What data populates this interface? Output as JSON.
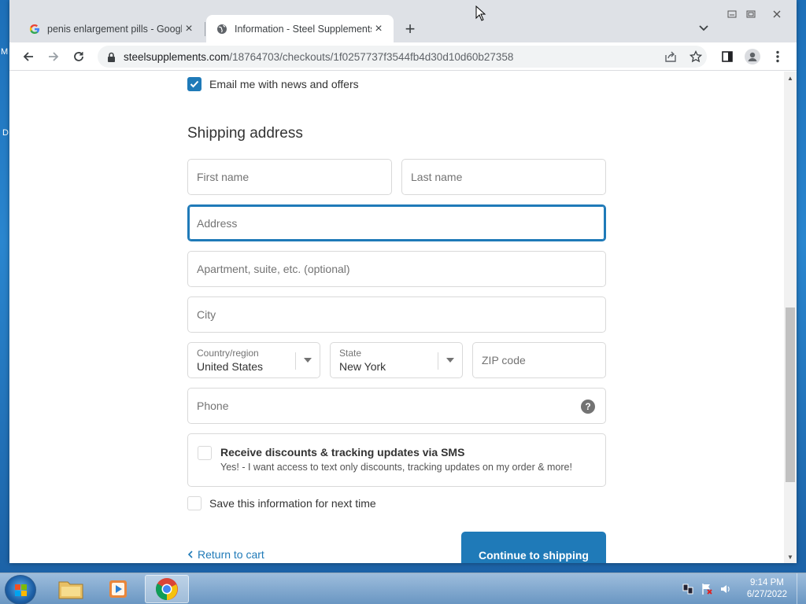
{
  "desktop": {
    "left_letters": [
      "M",
      "D"
    ]
  },
  "browser": {
    "tabs": [
      {
        "title": "penis enlargement pills - Google",
        "active": false,
        "icon": "google-g-icon"
      },
      {
        "title": "Information - Steel Supplements",
        "active": true,
        "icon": "globe-icon"
      }
    ],
    "url_domain": "steelsupplements.com",
    "url_path": "/18764703/checkouts/1f0257737f3544fb4d30d10d60b27358"
  },
  "form": {
    "email_opt_in_label": "Email me with news and offers",
    "email_opt_in_checked": true,
    "section_title": "Shipping address",
    "first_name_placeholder": "First name",
    "last_name_placeholder": "Last name",
    "address_placeholder": "Address",
    "apartment_placeholder": "Apartment, suite, etc. (optional)",
    "city_placeholder": "City",
    "country_label": "Country/region",
    "country_value": "United States",
    "state_label": "State",
    "state_value": "New York",
    "zip_placeholder": "ZIP code",
    "phone_placeholder": "Phone",
    "sms_title": "Receive discounts & tracking updates via SMS",
    "sms_desc": "Yes! - I want access to text only discounts, tracking updates on my order & more!",
    "save_info_label": "Save this information for next time",
    "return_link": "Return to cart",
    "continue_button": "Continue to shipping"
  },
  "colors": {
    "accent": "#1f7ab8",
    "border": "#d9d9d9",
    "text": "#333333"
  },
  "taskbar": {
    "time": "9:14 PM",
    "date": "6/27/2022"
  }
}
